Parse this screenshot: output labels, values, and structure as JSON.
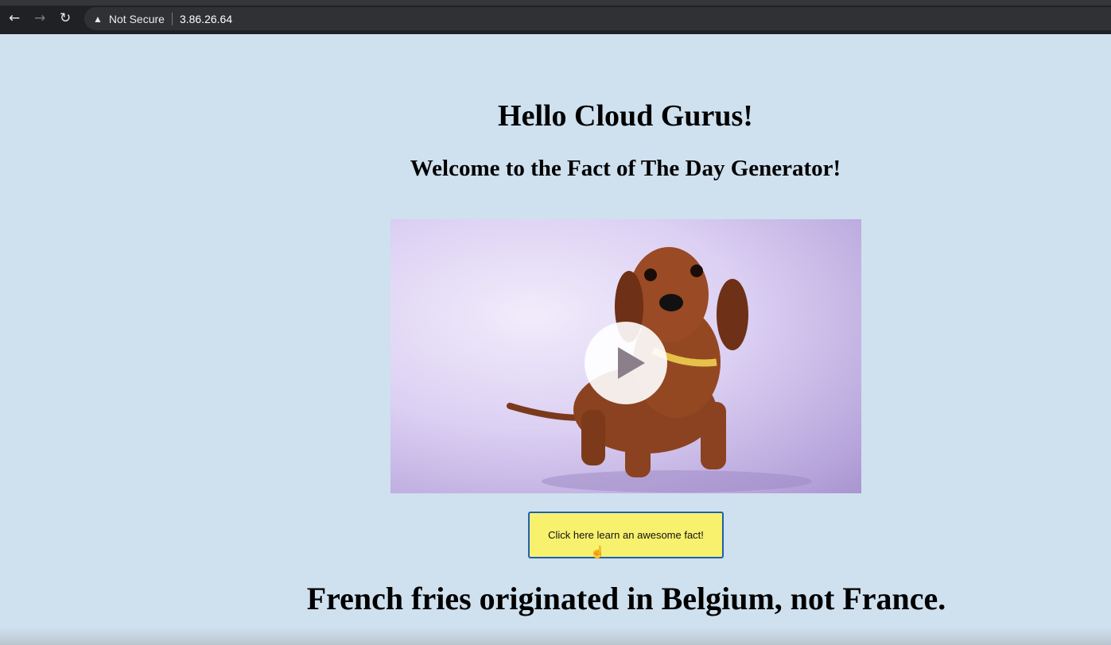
{
  "browser": {
    "security_label": "Not Secure",
    "url": "3.86.26.64",
    "icons": [
      "back-arrow-icon",
      "forward-arrow-icon",
      "reload-icon",
      "warning-icon"
    ]
  },
  "page": {
    "title": "Hello Cloud Gurus!",
    "subtitle": "Welcome to the Fact of The Day Generator!",
    "button_label": "Click here learn an awesome fact!",
    "fact": "French fries originated in Belgium, not France."
  },
  "colors": {
    "background": "#cfe0ee",
    "button": "#f8f16e",
    "button_border": "#1f5fb0"
  }
}
